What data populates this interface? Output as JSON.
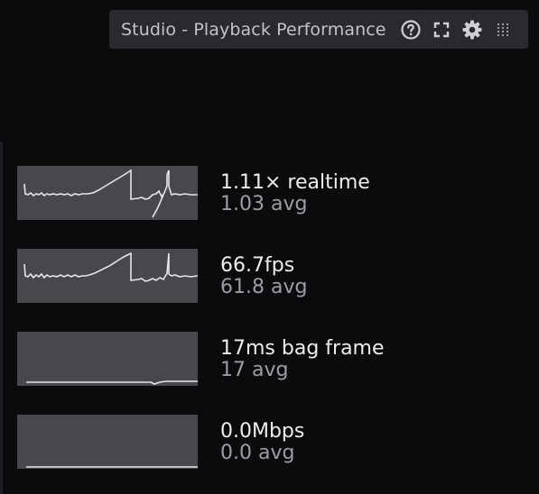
{
  "toolbar": {
    "title": "Studio - Playback Performance",
    "icons": [
      "help-icon",
      "fullscreen-icon",
      "settings-icon",
      "drag-handle-icon"
    ]
  },
  "metrics": [
    {
      "value": "1.11× realtime",
      "avg": "1.03 avg",
      "sparkline": "realtime-sparkline"
    },
    {
      "value": "66.7fps",
      "avg": "61.8 avg",
      "sparkline": "fps-sparkline"
    },
    {
      "value": "17ms bag frame",
      "avg": "17 avg",
      "sparkline": "bag-frame-sparkline"
    },
    {
      "value": "0.0Mbps",
      "avg": "0.0 avg",
      "sparkline": "bandwidth-sparkline"
    }
  ],
  "colors": {
    "background": "#0b0b0d",
    "toolbar": "#2a2a2e",
    "sparkline_bg": "#48484c",
    "sparkline_line": "#e6e6e8",
    "value_text": "#ededf0",
    "avg_text": "#9d9da2"
  }
}
